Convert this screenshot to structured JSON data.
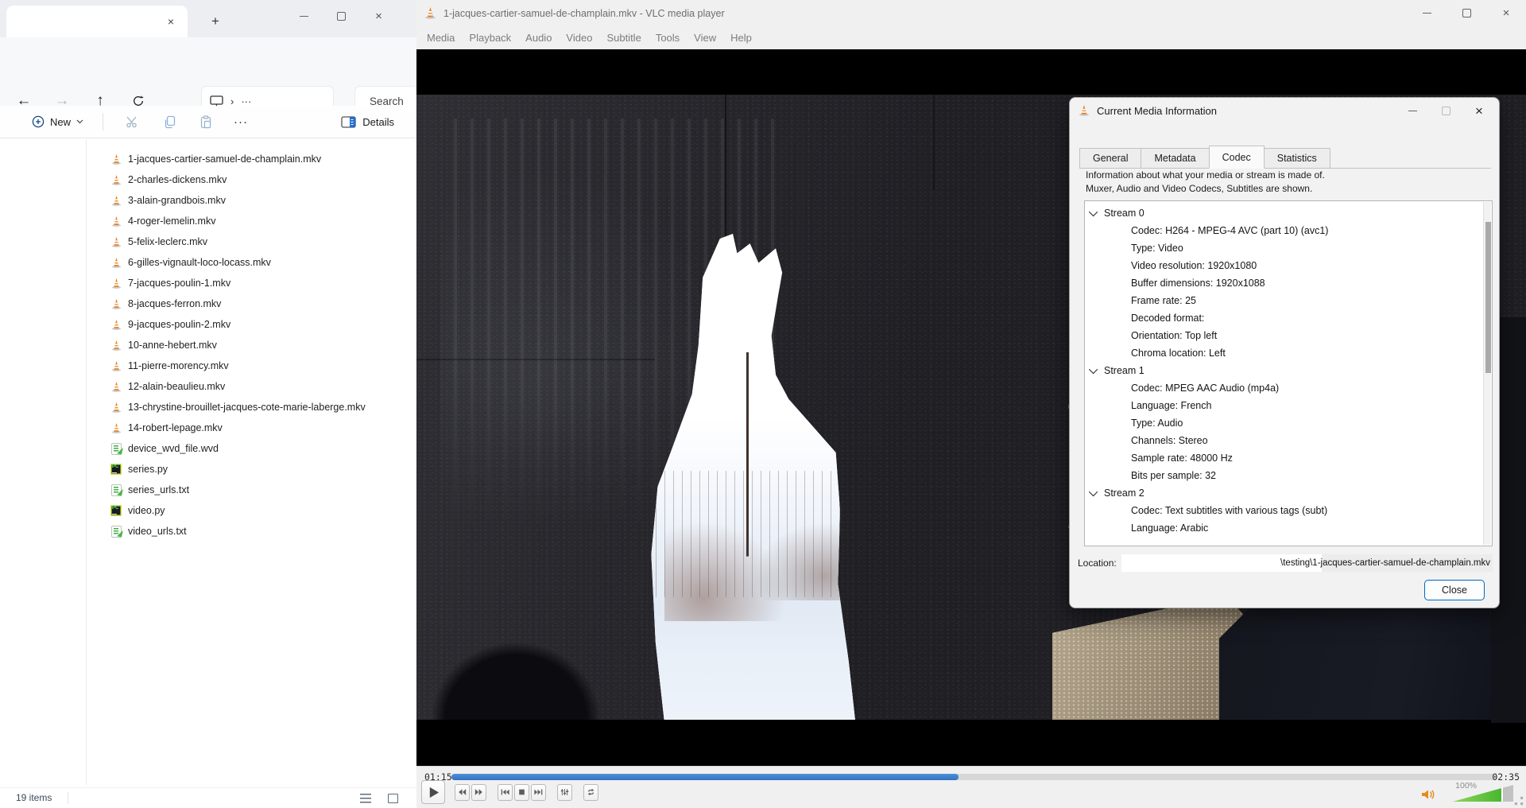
{
  "glyphs": {
    "close": "×",
    "minimize": "–",
    "new_tab": "+",
    "back": "←",
    "forward": "→",
    "up": "↑",
    "chevron_right": "›",
    "more_dots": "···",
    "chevron_down": "⌄"
  },
  "explorer": {
    "tab_title": "",
    "nav": {
      "search_placeholder": "Search"
    },
    "toolbar": {
      "new_label": "New",
      "details_label": "Details"
    },
    "files": [
      {
        "name": "1-jacques-cartier-samuel-de-champlain.mkv",
        "icon": "vlc-cone-icon"
      },
      {
        "name": "2-charles-dickens.mkv",
        "icon": "vlc-cone-icon"
      },
      {
        "name": "3-alain-grandbois.mkv",
        "icon": "vlc-cone-icon"
      },
      {
        "name": "4-roger-lemelin.mkv",
        "icon": "vlc-cone-icon"
      },
      {
        "name": "5-felix-leclerc.mkv",
        "icon": "vlc-cone-icon"
      },
      {
        "name": "6-gilles-vignault-loco-locass.mkv",
        "icon": "vlc-cone-icon"
      },
      {
        "name": "7-jacques-poulin-1.mkv",
        "icon": "vlc-cone-icon"
      },
      {
        "name": "8-jacques-ferron.mkv",
        "icon": "vlc-cone-icon"
      },
      {
        "name": "9-jacques-poulin-2.mkv",
        "icon": "vlc-cone-icon"
      },
      {
        "name": "10-anne-hebert.mkv",
        "icon": "vlc-cone-icon"
      },
      {
        "name": "11-pierre-morency.mkv",
        "icon": "vlc-cone-icon"
      },
      {
        "name": "12-alain-beaulieu.mkv",
        "icon": "vlc-cone-icon"
      },
      {
        "name": "13-chrystine-brouillet-jacques-cote-marie-laberge.mkv",
        "icon": "vlc-cone-icon"
      },
      {
        "name": "14-robert-lepage.mkv",
        "icon": "vlc-cone-icon"
      },
      {
        "name": "device_wvd_file.wvd",
        "icon": "text-file-icon"
      },
      {
        "name": "series.py",
        "icon": "pycharm-file-icon"
      },
      {
        "name": "series_urls.txt",
        "icon": "text-file-icon"
      },
      {
        "name": "video.py",
        "icon": "pycharm-file-icon"
      },
      {
        "name": "video_urls.txt",
        "icon": "text-file-icon"
      }
    ],
    "status": {
      "items_count": "19 items"
    }
  },
  "vlc": {
    "title": "1-jacques-cartier-samuel-de-champlain.mkv - VLC media player",
    "menus": [
      "Media",
      "Playback",
      "Audio",
      "Video",
      "Subtitle",
      "Tools",
      "View",
      "Help"
    ],
    "controls": {
      "current_time": "01:15",
      "total_time": "02:35",
      "progress_percent": 48.5,
      "volume_label": "100%",
      "volume_fill_percent": 82,
      "buttons": [
        "play",
        "rewind",
        "fast-forward",
        "previous",
        "stop",
        "next",
        "equalizer",
        "loop"
      ],
      "accent_blue": "#3372c0",
      "volume_green": "#37b021",
      "speaker_orange": "#e8891c"
    }
  },
  "dialog": {
    "title": "Current Media Information",
    "tabs": [
      {
        "label": "General",
        "active": false
      },
      {
        "label": "Metadata",
        "active": false
      },
      {
        "label": "Codec",
        "active": true
      },
      {
        "label": "Statistics",
        "active": false
      }
    ],
    "description_line1": "Information about what your media or stream is made of.",
    "description_line2": "Muxer, Audio and Video Codecs, Subtitles are shown.",
    "streams": [
      {
        "name": "Stream 0",
        "props": [
          "Codec: H264 - MPEG-4 AVC (part 10) (avc1)",
          "Type: Video",
          "Video resolution: 1920x1080",
          "Buffer dimensions: 1920x1088",
          "Frame rate: 25",
          "Decoded format:",
          "Orientation: Top left",
          "Chroma location: Left"
        ]
      },
      {
        "name": "Stream 1",
        "props": [
          "Codec: MPEG AAC Audio (mp4a)",
          "Language: French",
          "Type: Audio",
          "Channels: Stereo",
          "Sample rate: 48000 Hz",
          "Bits per sample: 32"
        ]
      },
      {
        "name": "Stream 2",
        "props": [
          "Codec: Text subtitles with various tags (subt)",
          "Language: Arabic"
        ]
      }
    ],
    "location_label": "Location:",
    "location_value": "\\testing\\1-jacques-cartier-samuel-de-champlain.mkv",
    "close_label": "Close"
  }
}
